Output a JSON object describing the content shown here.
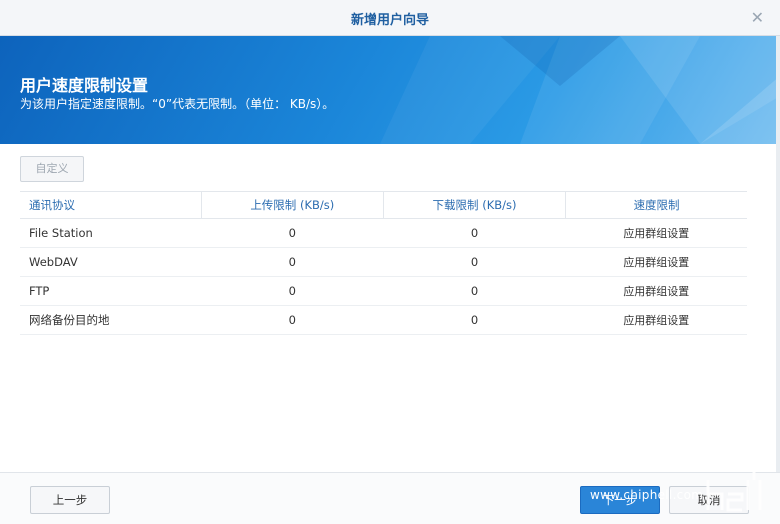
{
  "window": {
    "title": "新增用户向导",
    "close_icon": "close-icon"
  },
  "banner": {
    "heading": "用户速度限制设置",
    "description": "为该用户指定速度限制。“0”代表无限制。（单位： KB/s）。"
  },
  "toolbar": {
    "custom_label": "自定义"
  },
  "table": {
    "headers": [
      "通讯协议",
      "上传限制 (KB/s)",
      "下载限制 (KB/s)",
      "速度限制"
    ],
    "rows": [
      {
        "protocol": "File Station",
        "upload": "0",
        "download": "0",
        "speed": "应用群组设置"
      },
      {
        "protocol": "WebDAV",
        "upload": "0",
        "download": "0",
        "speed": "应用群组设置"
      },
      {
        "protocol": "FTP",
        "upload": "0",
        "download": "0",
        "speed": "应用群组设置"
      },
      {
        "protocol": "网络备份目的地",
        "upload": "0",
        "download": "0",
        "speed": "应用群组设置"
      }
    ]
  },
  "footer": {
    "prev_label": "上一步",
    "next_label": "下一步",
    "cancel_label": "取消"
  },
  "watermark": {
    "text": "www.chiphell.com",
    "logo": "chiphell"
  },
  "colors": {
    "banner": "#1b86d9",
    "accent": "#2a85d8",
    "header_text": "#2b6cb0"
  }
}
